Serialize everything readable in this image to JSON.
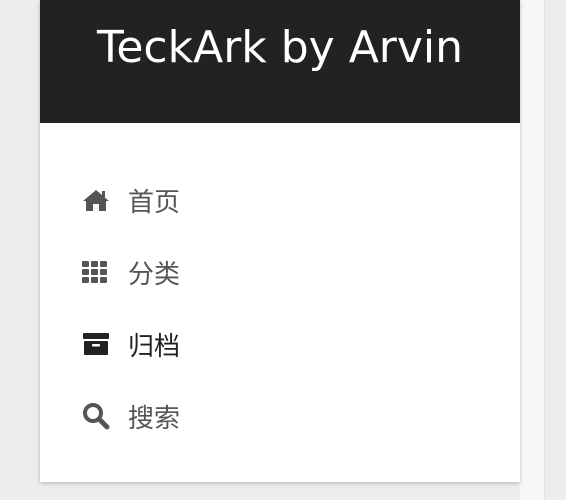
{
  "brand": {
    "title": "TeckArk by Arvin"
  },
  "menu": {
    "items": [
      {
        "label": "首页",
        "icon": "home-icon"
      },
      {
        "label": "分类",
        "icon": "grid-icon"
      },
      {
        "label": "归档",
        "icon": "archive-icon",
        "active": true
      },
      {
        "label": "搜索",
        "icon": "search-icon"
      }
    ]
  },
  "colors": {
    "header_bg": "#222222",
    "header_text": "#ffffff",
    "item_text": "#555555",
    "active_text": "#222222",
    "page_bg": "#ededed"
  }
}
